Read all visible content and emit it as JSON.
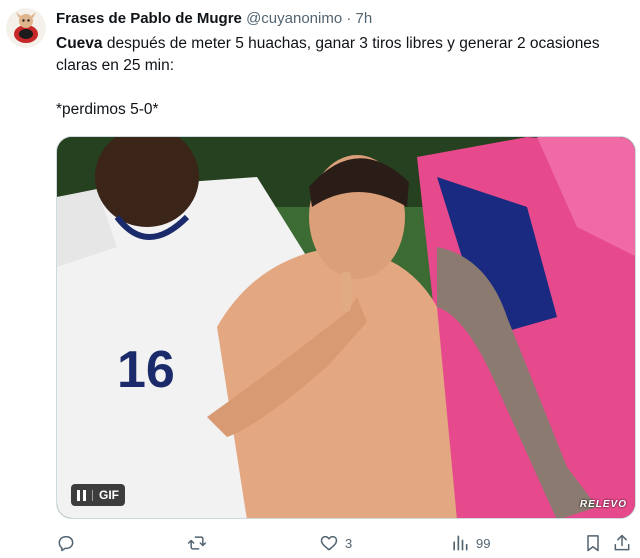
{
  "tweet": {
    "author_name": "Frases de Pablo de Mugre",
    "handle": "@cuyanonimo",
    "separator": "·",
    "time": "7h",
    "text_bold": "Cueva",
    "text_rest": " después de meter 5 huachas, ganar 3 tiros libres y generar 2 ocasiones claras en 25 min:",
    "text_second": "*perdimos 5-0*"
  },
  "media": {
    "badge_label": "GIF",
    "watermark": "RELEVO",
    "jersey_number": "16"
  },
  "actions": {
    "replies": "",
    "retweets": "",
    "likes": "3",
    "views": "99"
  },
  "icons": {
    "avatar": "cartoon-avatar",
    "reply": "reply-icon",
    "retweet": "retweet-icon",
    "like": "heart-icon",
    "views": "views-icon",
    "bookmark": "bookmark-icon",
    "share": "share-icon",
    "pause": "pause-icon"
  }
}
